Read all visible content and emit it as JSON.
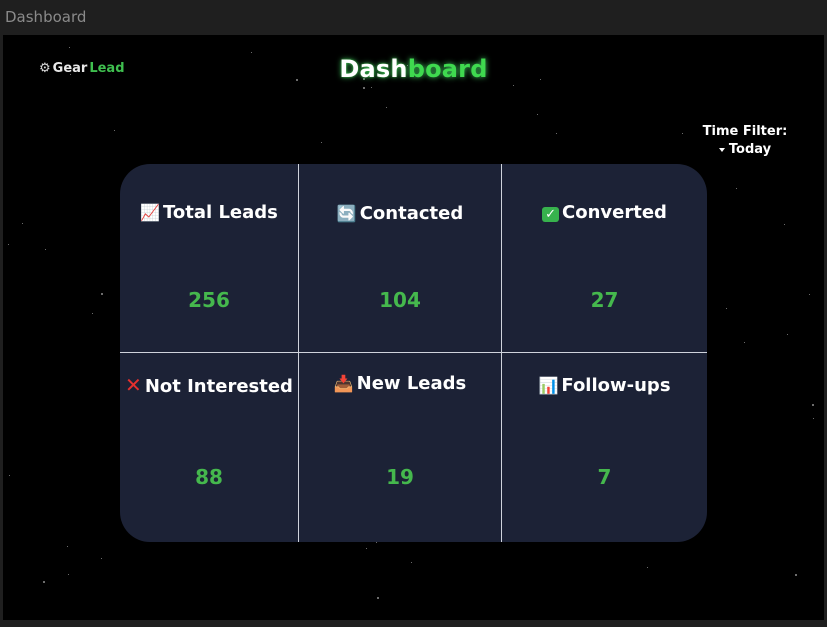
{
  "window": {
    "title": "Dashboard"
  },
  "logo": {
    "icon": "gear-icon",
    "part1": "Gear",
    "part2": "Lead"
  },
  "header": {
    "title_part1": "Dash",
    "title_part2": "board"
  },
  "time_filter": {
    "label": "Time Filter:",
    "selected": "Today"
  },
  "cards": [
    {
      "label": "Total Leads",
      "value": "256",
      "icon": "chart-increasing-icon"
    },
    {
      "label": "Contacted",
      "value": "104",
      "icon": "refresh-icon"
    },
    {
      "label": "Converted",
      "value": "27",
      "icon": "check-mark-icon"
    },
    {
      "label": "Not Interested",
      "value": "88",
      "icon": "cross-mark-icon"
    },
    {
      "label": "New Leads",
      "value": "19",
      "icon": "inbox-tray-icon"
    },
    {
      "label": "Follow-ups",
      "value": "7",
      "icon": "bar-chart-icon"
    }
  ],
  "colors": {
    "background": "#000000",
    "panel": "#1c2236",
    "accent_green": "#45b84d",
    "title_green": "#3fd94f"
  }
}
